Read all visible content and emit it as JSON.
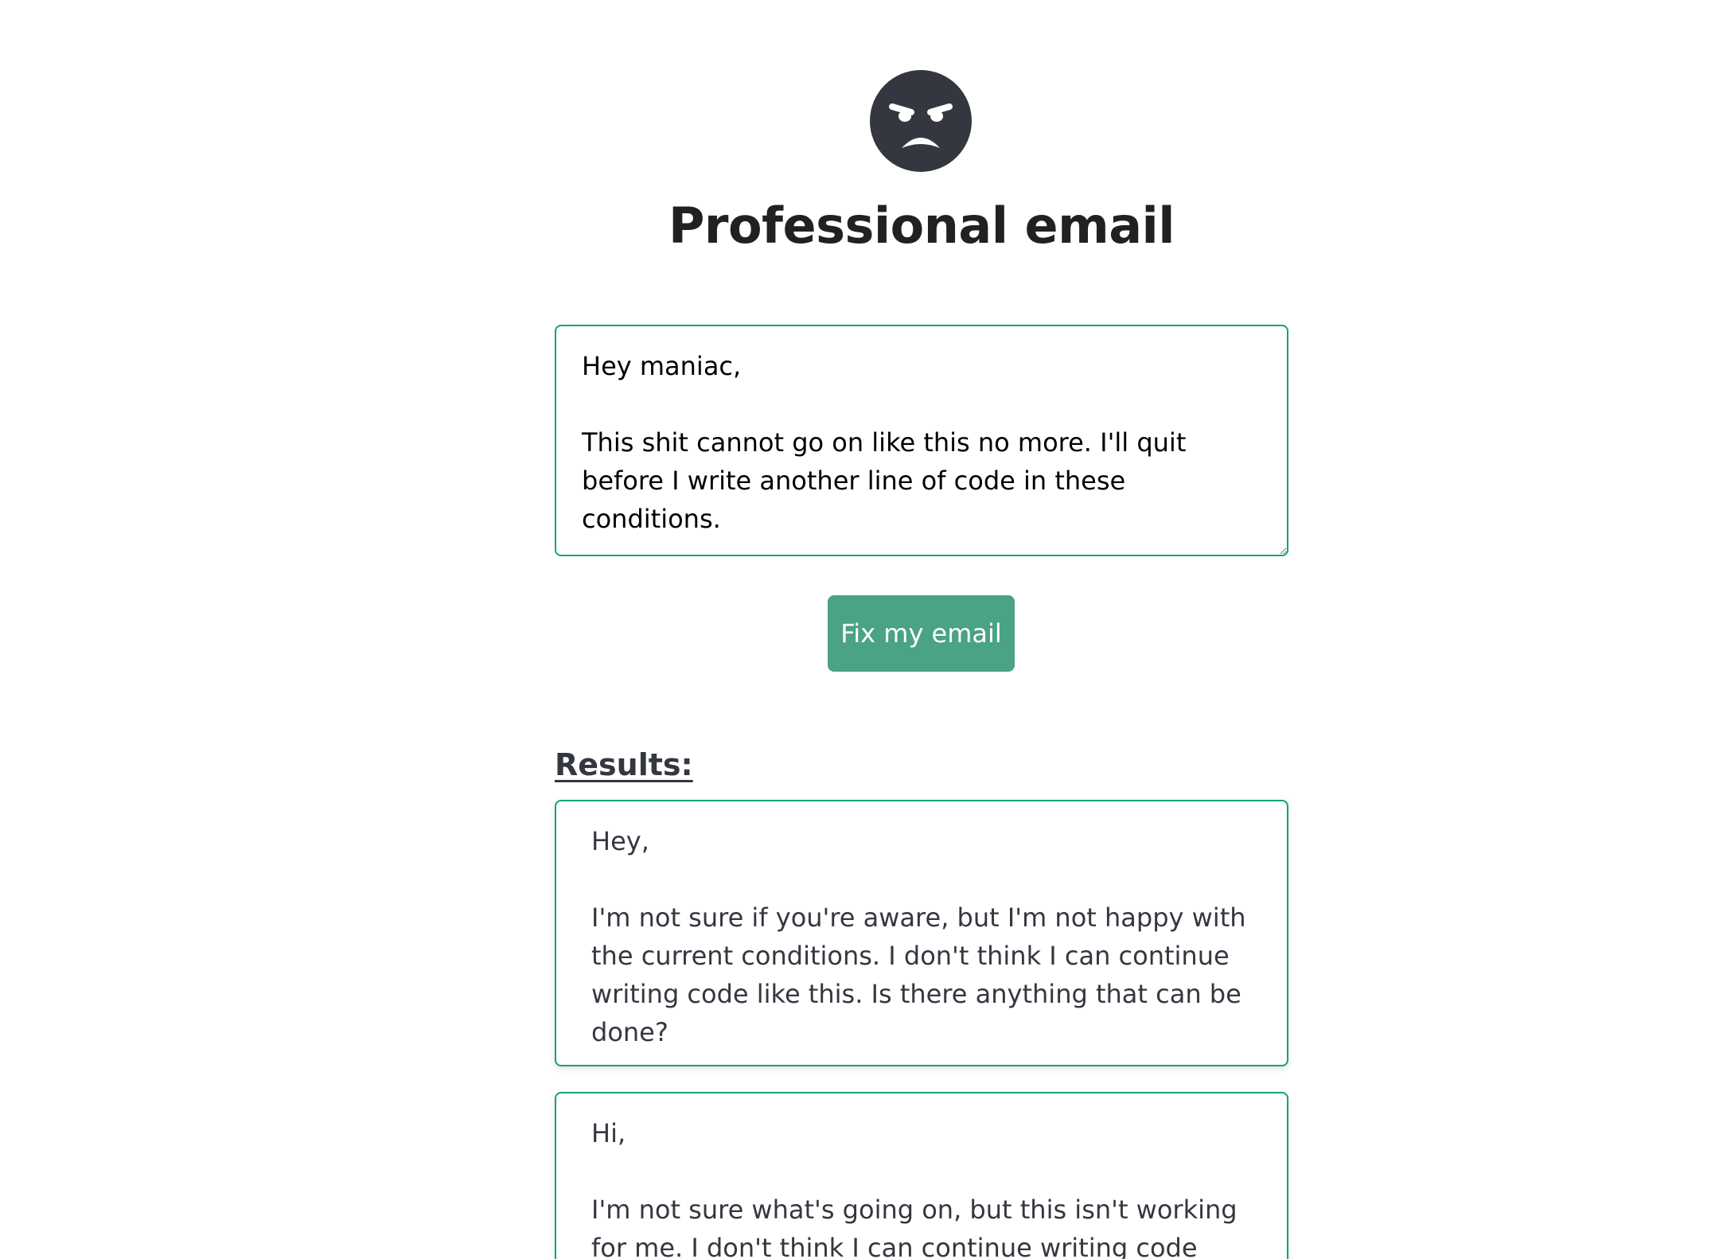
{
  "header": {
    "icon": "angry-face-icon",
    "title": "Professional email"
  },
  "input": {
    "value": "Hey maniac,\n\nThis shit cannot go on like this no more. I'll quit before I write another line of code in these conditions."
  },
  "actions": {
    "fix_label": "Fix my email"
  },
  "results": {
    "heading": "Results:",
    "items": [
      {
        "text": "Hey,\n\nI'm not sure if you're aware, but I'm not happy with the current conditions. I don't think I can continue writing code like this. Is there anything that can be done?"
      },
      {
        "text": "Hi,\n\nI'm not sure what's going on, but this isn't working for me. I don't think I can continue writing code under these conditions."
      }
    ]
  },
  "colors": {
    "accent": "#10a37f",
    "button": "#4aa383",
    "icon_bg": "#353740",
    "title": "#202123"
  }
}
